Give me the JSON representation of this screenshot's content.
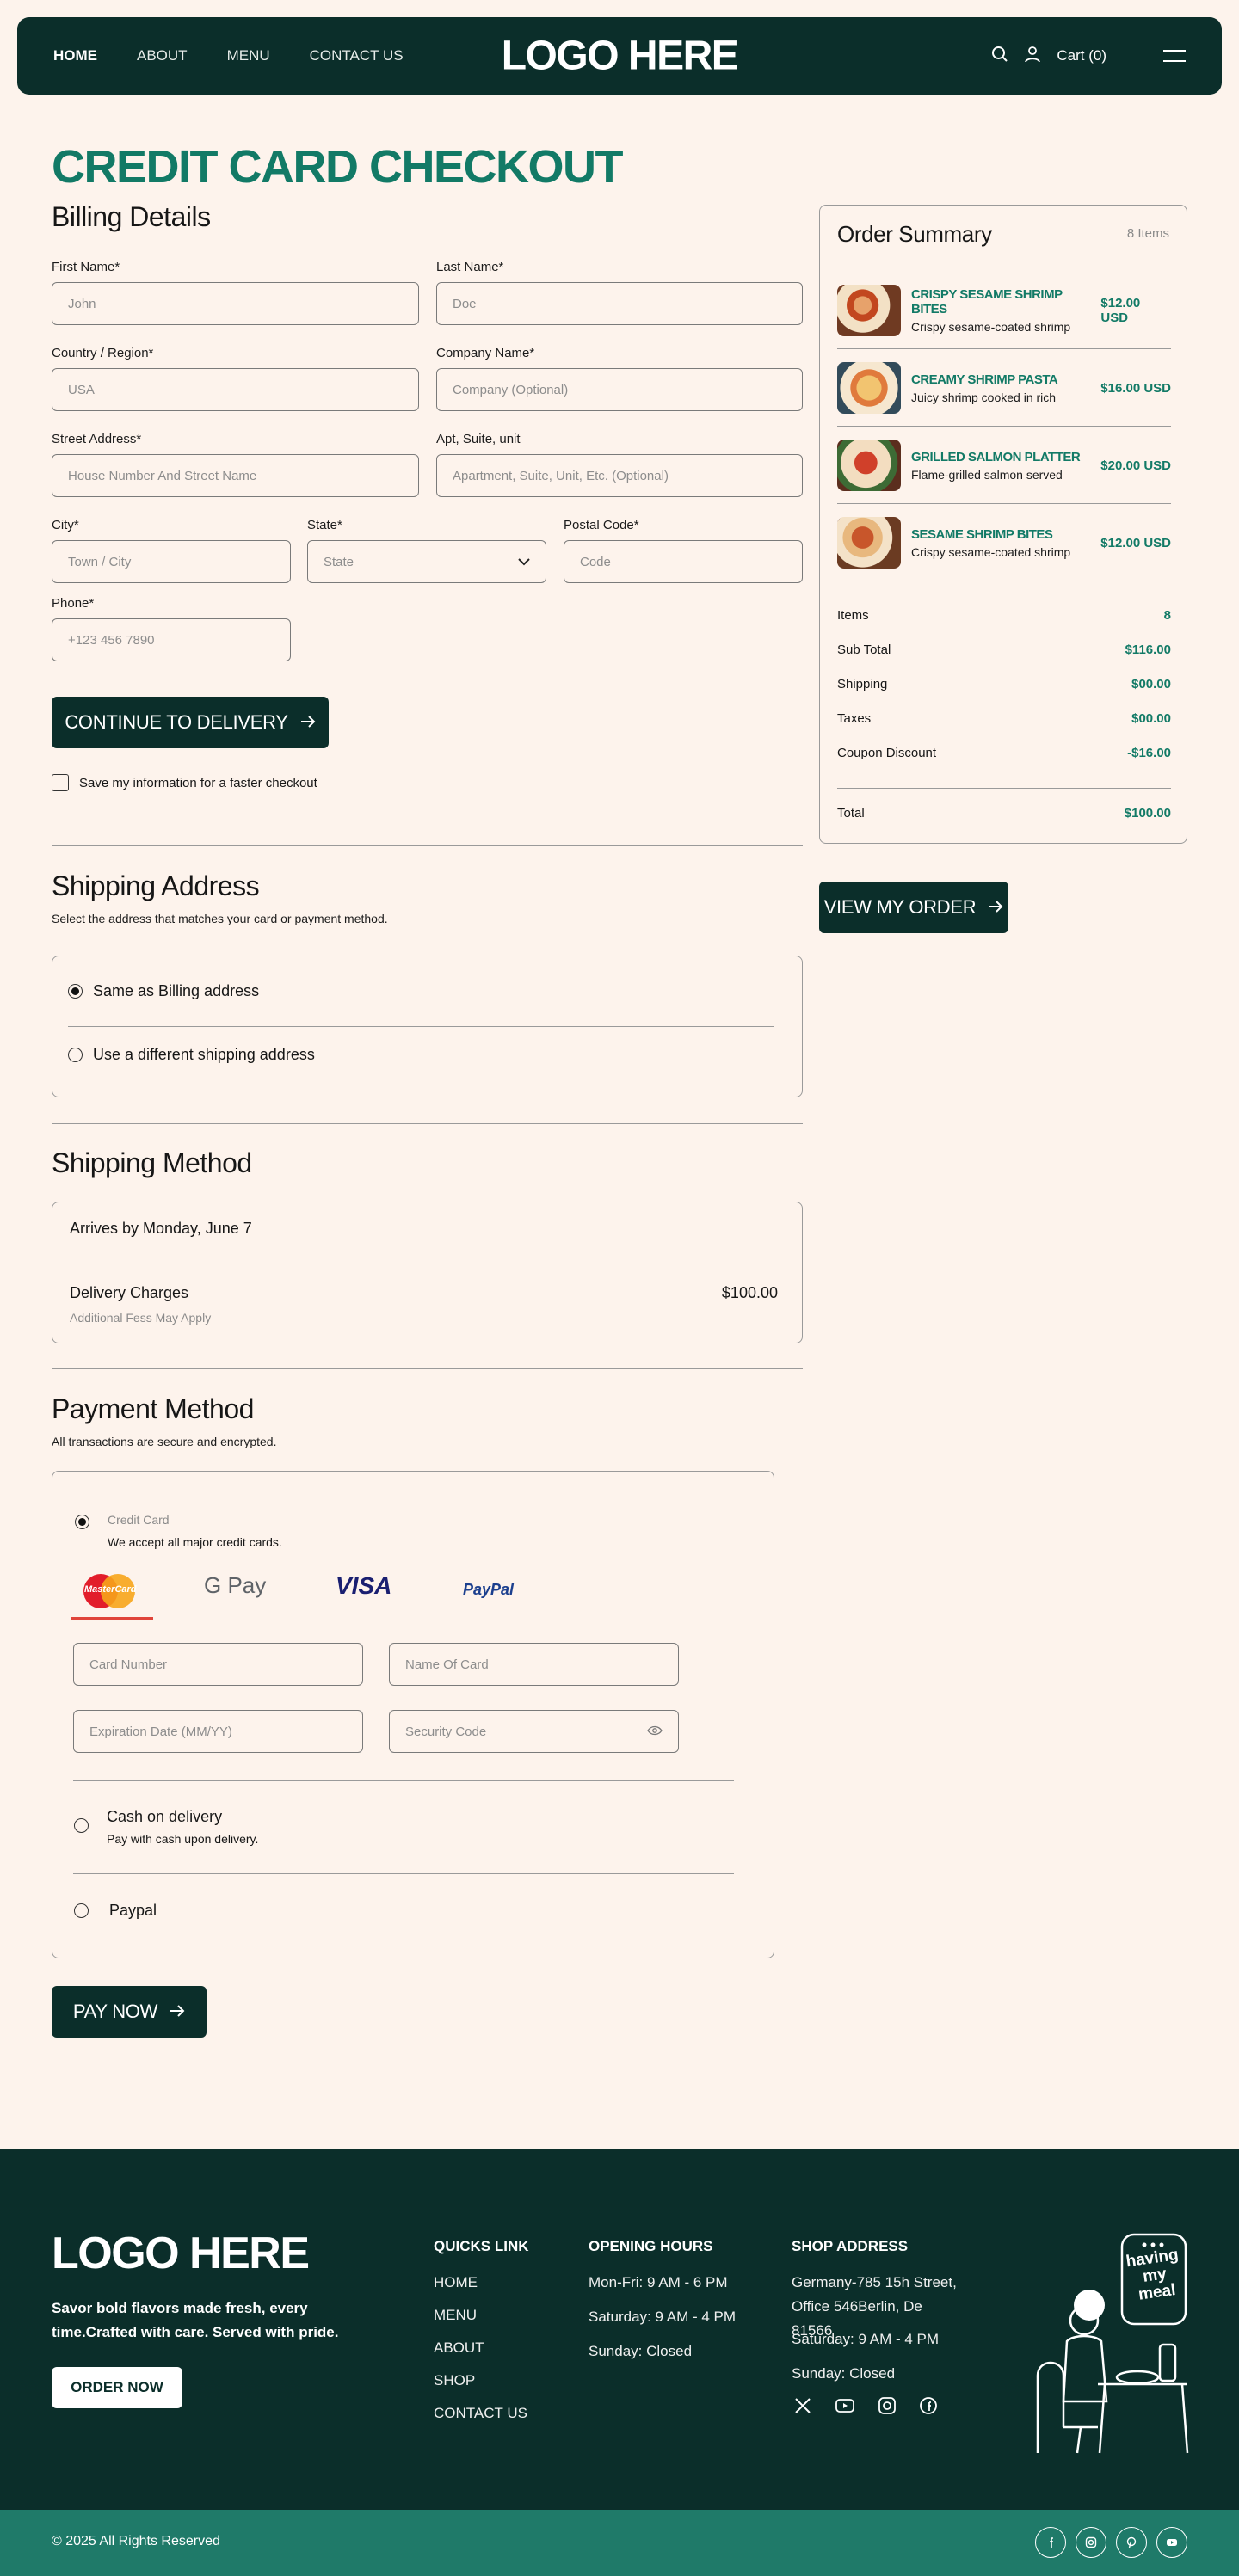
{
  "header": {
    "nav": [
      "HOME",
      "ABOUT",
      "MENU",
      "CONTACT US"
    ],
    "logo": "LOGO HERE",
    "cart": "Cart (0)"
  },
  "page_title": "CREDIT CARD CHECKOUT",
  "billing": {
    "title": "Billing Details",
    "first_name_label": "First Name*",
    "first_name_placeholder": "John",
    "last_name_label": "Last Name*",
    "last_name_placeholder": "Doe",
    "country_label": "Country / Region*",
    "country_placeholder": "USA",
    "company_label": "Company Name*",
    "company_placeholder": "Company (Optional)",
    "street_label": "Street Address*",
    "street_placeholder": "House Number And Street Name",
    "apt_label": "Apt, Suite, unit",
    "apt_placeholder": "Apartment, Suite, Unit, Etc. (Optional)",
    "city_label": "City*",
    "city_placeholder": "Town / City",
    "state_label": "State*",
    "state_placeholder": "State",
    "postal_label": "Postal Code*",
    "postal_placeholder": "Code",
    "phone_label": "Phone*",
    "phone_placeholder": "+123 456 7890",
    "continue_button": "CONTINUE TO DELIVERY",
    "save_info": "Save my information for a faster checkout"
  },
  "shipping_address": {
    "title": "Shipping Address",
    "subtitle": "Select the address that matches your card or payment method.",
    "option_same": "Same as Billing address",
    "option_different": "Use a different shipping address"
  },
  "shipping_method": {
    "title": "Shipping Method",
    "arrives": "Arrives by Monday, June 7",
    "delivery_label": "Delivery Charges",
    "delivery_note": "Additional Fess May Apply",
    "delivery_price": "$100.00"
  },
  "payment": {
    "title": "Payment Method",
    "subtitle": "All transactions are secure and encrypted.",
    "credit_title": "Credit Card",
    "credit_sub": "We accept all major credit cards.",
    "logos": [
      "MasterCard",
      "G Pay",
      "VISA",
      "PayPal"
    ],
    "card_number_placeholder": "Card Number",
    "name_on_card_placeholder": "Name Of Card",
    "expiration_placeholder": "Expiration Date (MM/YY)",
    "security_placeholder": "Security Code",
    "cod_title": "Cash on delivery",
    "cod_sub": "Pay with cash upon delivery.",
    "paypal_title": "Paypal",
    "pay_button": "PAY NOW"
  },
  "order_summary": {
    "title": "Order Summary",
    "count": "8 Items",
    "items": [
      {
        "name": "CRISPY SESAME SHRIMP BITES",
        "desc": "Crispy sesame-coated shrimp",
        "price": "$12.00 USD"
      },
      {
        "name": "CREAMY SHRIMP PASTA",
        "desc": "Juicy shrimp cooked in rich",
        "price": "$16.00 USD"
      },
      {
        "name": "GRILLED SALMON PLATTER",
        "desc": "Flame-grilled salmon served",
        "price": "$20.00 USD"
      },
      {
        "name": "SESAME SHRIMP BITES",
        "desc": "Crispy sesame-coated shrimp",
        "price": "$12.00 USD"
      }
    ],
    "lines": [
      {
        "label": "Items",
        "value": "8"
      },
      {
        "label": "Sub Total",
        "value": "$116.00"
      },
      {
        "label": "Shipping",
        "value": "$00.00"
      },
      {
        "label": "Taxes",
        "value": "$00.00"
      },
      {
        "label": "Coupon Discount",
        "value": "-$16.00"
      }
    ],
    "total_label": "Total",
    "total_value": "$100.00",
    "view_button": "VIEW MY ORDER"
  },
  "footer": {
    "logo": "LOGO HERE",
    "tagline": "Savor bold flavors made fresh, every time.Crafted with care. Served with pride.",
    "order_button": "ORDER NOW",
    "quick_title": "QUICKS LINK",
    "quick_links": [
      "HOME",
      "MENU",
      "ABOUT",
      "SHOP",
      "CONTACT US"
    ],
    "hours_title": "OPENING HOURS",
    "hours": [
      "Mon-Fri: 9 AM - 6 PM",
      "Saturday: 9 AM - 4 PM",
      "Sunday: Closed"
    ],
    "address_title": "SHOP ADDRESS",
    "address": "Germany-785 15h Street, Office 546Berlin, De 81566",
    "addr_hours": [
      "Saturday: 9 AM - 4 PM",
      "Sunday: Closed"
    ],
    "illustration_text": "having my meal",
    "copyright": "© 2025 All Rights Reserved"
  }
}
